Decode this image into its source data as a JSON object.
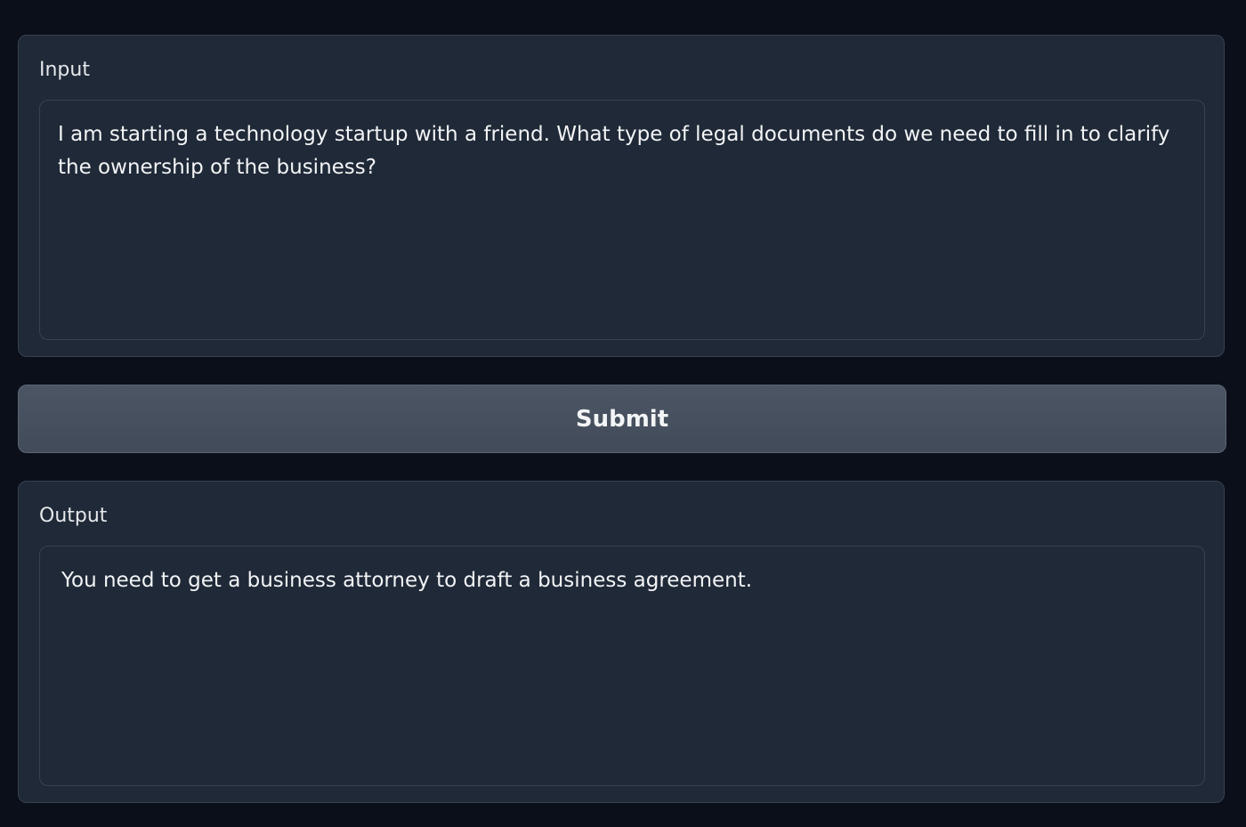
{
  "input": {
    "label": "Input",
    "value": "I am starting a technology startup with a friend. What type of legal documents do we need to fill in to clarify the ownership of the business?"
  },
  "submit": {
    "label": "Submit"
  },
  "output": {
    "label": "Output",
    "value": "You need to get a business attorney to draft a business agreement."
  },
  "colors": {
    "background": "#0b0f1a",
    "panel": "#1f2937",
    "border": "#374151",
    "button": "#4b5563",
    "text": "#f3f4f6"
  }
}
